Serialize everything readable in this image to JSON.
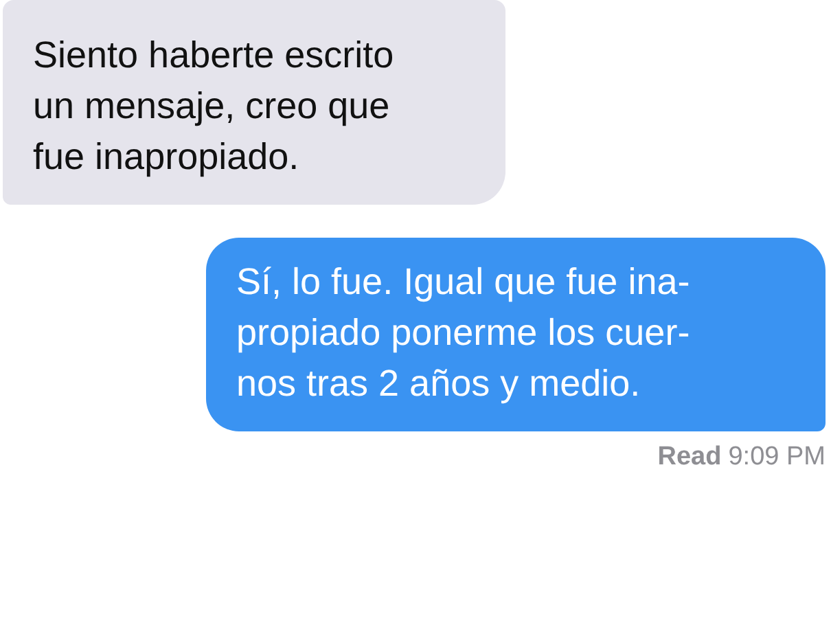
{
  "messages": [
    {
      "kind": "received",
      "text": "Siento haberte escrito\nun mensaje, creo que\nfue inapropiado."
    },
    {
      "kind": "sent",
      "text": "Sí, lo fue. Igual que fue ina-\npropiado ponerme los cuer-\nnos tras 2 años y medio."
    }
  ],
  "receipt": {
    "label": "Read",
    "time": "9:09 PM"
  }
}
